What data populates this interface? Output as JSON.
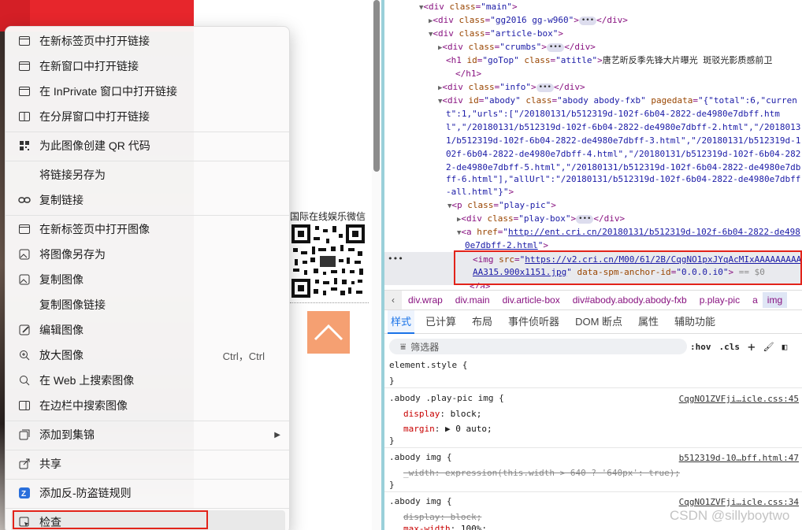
{
  "page": {
    "qr_caption": "国际在线娱乐微信"
  },
  "menu": {
    "items": [
      {
        "label": "在新标签页中打开链接"
      },
      {
        "label": "在新窗口中打开链接"
      },
      {
        "label": "在 InPrivate 窗口中打开链接"
      },
      {
        "label": "在分屏窗口中打开链接"
      },
      {
        "label": "为此图像创建 QR 代码"
      },
      {
        "label": "将链接另存为"
      },
      {
        "label": "复制链接"
      },
      {
        "label": "在新标签页中打开图像"
      },
      {
        "label": "将图像另存为"
      },
      {
        "label": "复制图像"
      },
      {
        "label": "复制图像链接"
      },
      {
        "label": "编辑图像"
      },
      {
        "label": "放大图像",
        "shortcut": "Ctrl，Ctrl"
      },
      {
        "label": "在 Web 上搜索图像"
      },
      {
        "label": "在边栏中搜索图像"
      },
      {
        "label": "添加到集锦"
      },
      {
        "label": "共享"
      },
      {
        "label": "添加反-防盗链规则"
      },
      {
        "label": "检查"
      }
    ]
  },
  "devtools": {
    "dom": {
      "main": "main",
      "gg": "gg2016 gg-w960",
      "article": "article-box",
      "crumbs": "crumbs",
      "h1_id": "goTop",
      "h1_class": "atitle",
      "h1_text": "唐艺昕反季先锋大片曝光 斑驳光影质感前卫",
      "info": "info",
      "abody_id": "abody",
      "abody_class": "abody abody-fxb",
      "pagedata_1": "\"{\"total\":6,\"curren",
      "pagedata_2": "t\":1,\"urls\":[\"/20180131/b512319d-102f-6b04-2822-de4980e7dbff.htm",
      "pagedata_3": "l\",\"/20180131/b512319d-102f-6b04-2822-de4980e7dbff-2.html\",\"/2018013",
      "pagedata_4": "1/b512319d-102f-6b04-2822-de4980e7dbff-3.html\",\"/20180131/b512319d-1",
      "pagedata_5": "02f-6b04-2822-de4980e7dbff-4.html\",\"/20180131/b512319d-102f-6b04-282",
      "pagedata_6": "2-de4980e7dbff-5.html\",\"/20180131/b512319d-102f-6b04-2822-de4980e7db",
      "pagedata_7": "ff-6.html\"],\"allUrl\":\"/20180131/b512319d-102f-6b04-2822-de4980e7dbff",
      "pagedata_8": "-all.html\"}\"",
      "playpic": "play-pic",
      "playbox": "play-box",
      "href_1": "http://ent.cri.cn/20180131/b512319d-102f-6b04-2822-de498",
      "href_2": "0e7dbff-2.html",
      "img_src_1": "https://v2.cri.cn/M00/61/2B/CqgNO1pxJYqAcMIxAAAAAAAAAA",
      "img_src_2": "AA315.900x1151.jpg",
      "spm": "0.0.0.i0",
      "dollar": "== $0"
    },
    "breadcrumbs": [
      "div.wrap",
      "div.main",
      "div.article-box",
      "div#abody.abody.abody-fxb",
      "p.play-pic",
      "a",
      "img"
    ],
    "tabs": [
      "样式",
      "已计算",
      "布局",
      "事件侦听器",
      "DOM 断点",
      "属性",
      "辅助功能"
    ],
    "filter_placeholder": "筛选器",
    "filter_tools": [
      ":hov",
      ".cls"
    ],
    "styles": {
      "element_style": "element.style {",
      "rule1_selector": ".abody .play-pic img {",
      "rule1_source": "CqgNO1ZVFji…icle.css:45",
      "rule1_p1_name": "display",
      "rule1_p1_val": "block;",
      "rule1_p2_name": "margin",
      "rule1_p2_val": "0 auto;",
      "rule2_selector": ".abody img {",
      "rule2_source": "b512319d-10…bff.html:47",
      "rule2_prop": "_width: expression(this.width > 640 ? '640px': true);",
      "rule3_selector": ".abody img {",
      "rule3_source": "CqgNO1ZVFji…icle.css:34",
      "rule3_p1": "display: block;",
      "rule3_p2_name": "max-width",
      "rule3_p2_val": "100%;",
      "close": "}"
    }
  },
  "watermark": "CSDN @sillyboytwo"
}
